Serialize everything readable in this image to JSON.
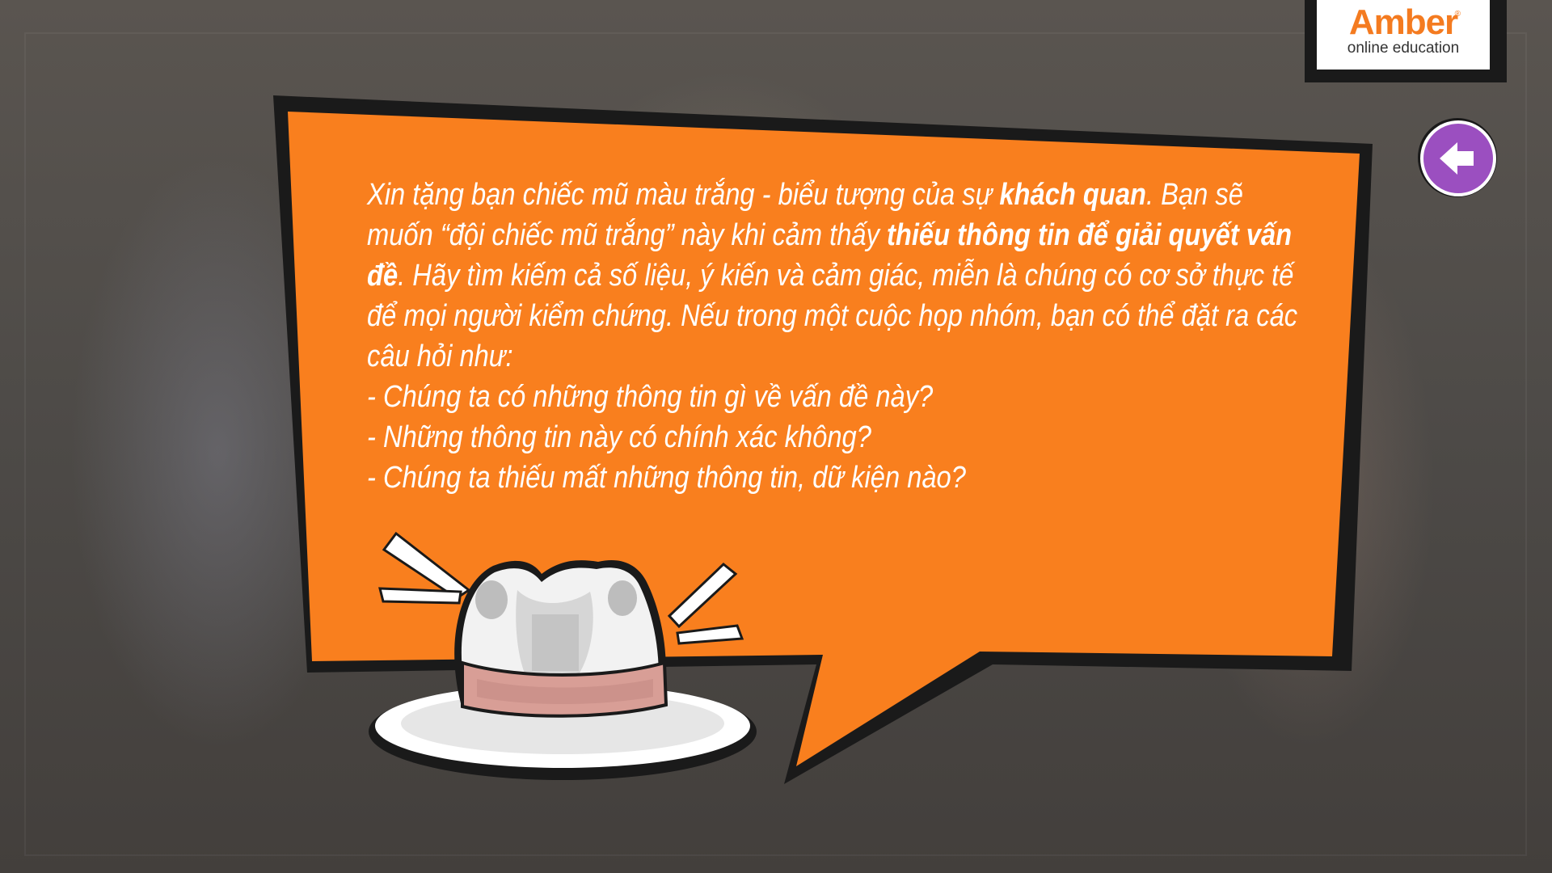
{
  "logo": {
    "brand": "Amber",
    "tagline": "online education",
    "registered": "®"
  },
  "back_button": {
    "icon": "arrow-left-icon",
    "color": "#9b4fc0"
  },
  "bubble": {
    "color": "#f97f1e",
    "paragraph": {
      "p1": "Xin tặng bạn chiếc mũ màu trắng - biểu tượng của sự ",
      "b1": "khách quan",
      "p2": ". Bạn sẽ muốn “đội chiếc mũ trắng” này khi cảm thấy ",
      "b2": "thiếu thông tin để giải quyết vấn đề",
      "p3": ". Hãy tìm kiếm cả số liệu, ý kiến và cảm giác, miễn là chúng có cơ sở thực tế để mọi người kiểm chứng. Nếu trong một cuộc họp nhóm, bạn có thể đặt ra các câu hỏi như:"
    },
    "questions": [
      "- Chúng ta có những thông tin gì về vấn đề này?",
      "- Những thông tin này có chính xác không?",
      "- Chúng ta thiếu mất những thông tin, dữ kiện nào?"
    ]
  },
  "illustration": {
    "icon": "white-hat-icon"
  }
}
